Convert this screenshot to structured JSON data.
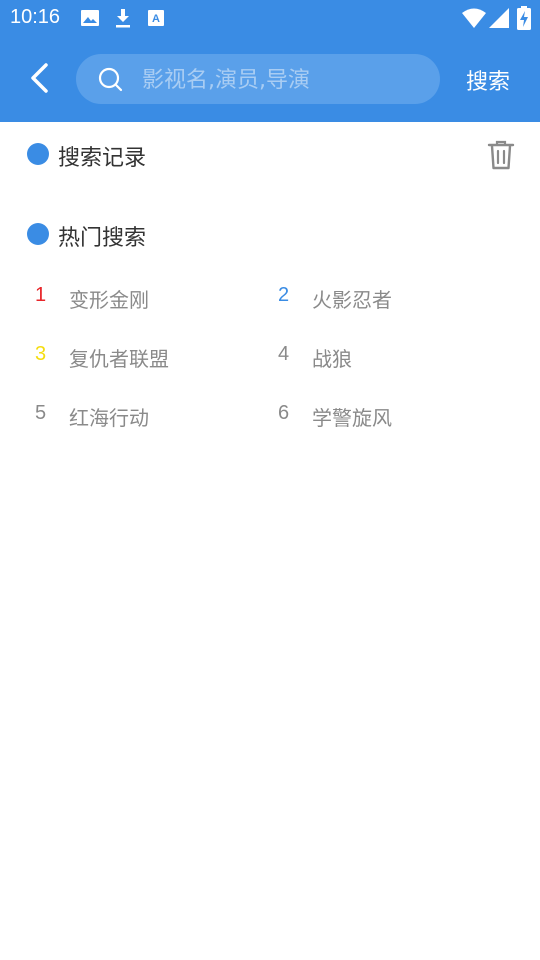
{
  "status_bar": {
    "time": "10:16",
    "left_icons": [
      "image-icon",
      "download-icon",
      "font-icon"
    ],
    "right_icons": [
      "wifi-icon",
      "signal-icon",
      "battery-charging-icon"
    ]
  },
  "header": {
    "back_icon": "chevron-left-icon",
    "search": {
      "placeholder": "影视名,演员,导演",
      "value": ""
    },
    "search_button": "搜索"
  },
  "history": {
    "title": "搜索记录",
    "delete_icon": "trash-icon",
    "items": []
  },
  "hot": {
    "title": "热门搜索",
    "items": [
      {
        "rank": "1",
        "name": "变形金刚",
        "rank_color": "#e8262a"
      },
      {
        "rank": "2",
        "name": "火影忍者",
        "rank_color": "#3a8ce4"
      },
      {
        "rank": "3",
        "name": "复仇者联盟",
        "rank_color": "#f5dd0f"
      },
      {
        "rank": "4",
        "name": "战狼",
        "rank_color": "#8a8a8a"
      },
      {
        "rank": "5",
        "name": "红海行动",
        "rank_color": "#8a8a8a"
      },
      {
        "rank": "6",
        "name": "学警旋风",
        "rank_color": "#8a8a8a"
      }
    ]
  },
  "colors": {
    "primary": "#3a8ce4",
    "text_dark": "#333333",
    "text_grey": "#8a8a8a"
  }
}
